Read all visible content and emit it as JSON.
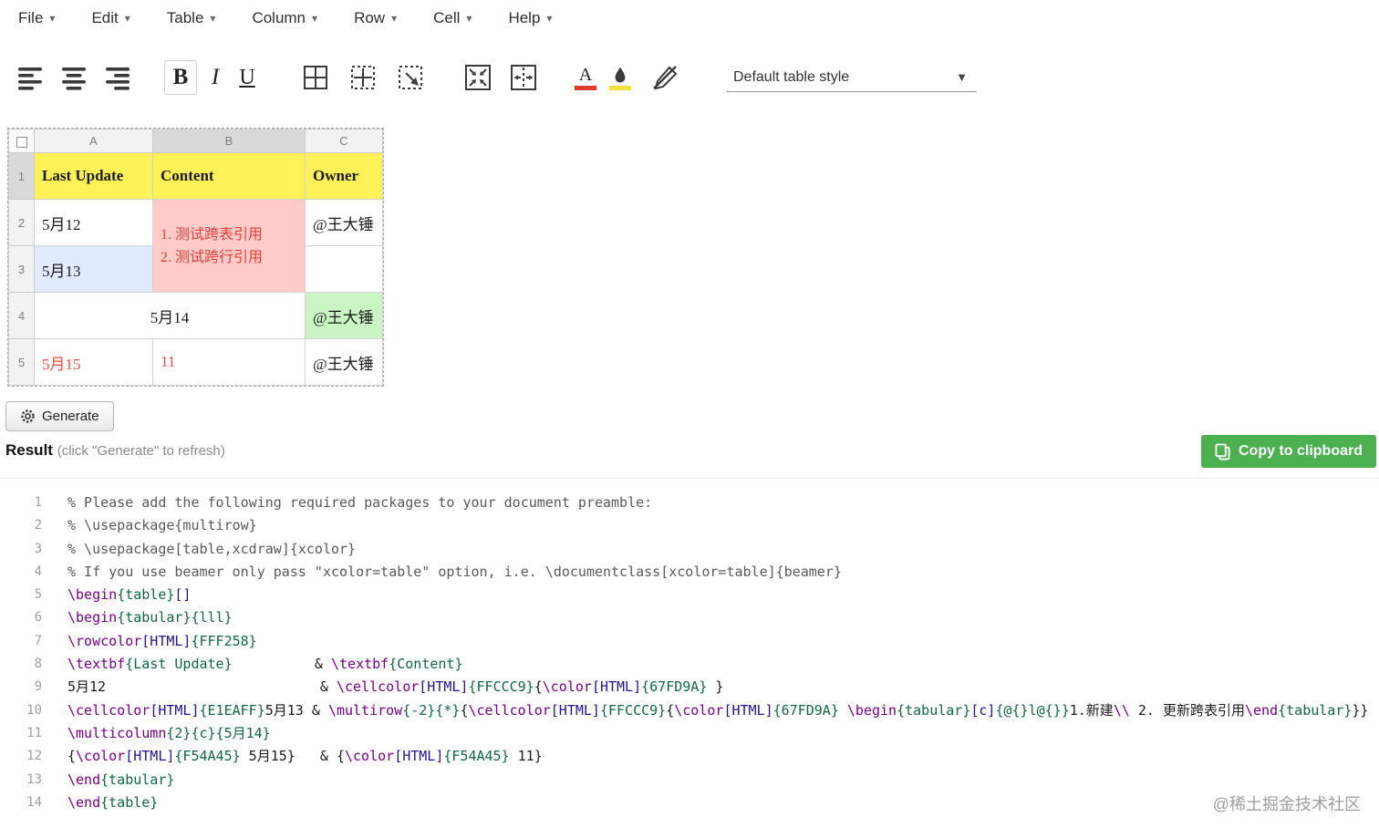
{
  "colors": {
    "copy_button": "#4caf50",
    "accent_red": "#e23b2e",
    "accent_yellow": "#f1e13d",
    "syntax": {
      "comment": "#595959",
      "command": "#770088",
      "brace_arg": "#116644",
      "bracket_arg": "#221199",
      "plain": "#1b1b1b"
    }
  },
  "icons": {
    "align-left-icon": "bars-left",
    "align-center-icon": "bars-center",
    "align-right-icon": "bars-right",
    "border-all-icon": "square-cross",
    "border-inner-icon": "dashed-square-cross",
    "border-custom-icon": "dashed-square-arrow",
    "merge-cells-icon": "box-arrows-inward",
    "split-cells-icon": "box-arrows-outward",
    "text-color-icon": "letter-A-red-bar",
    "fill-color-icon": "droplet-yellow-bar",
    "clear-formatting-icon": "pen-slash",
    "gear-icon": "cog",
    "clipboard-icon": "copy-sheets",
    "select-all-checkbox": "empty-square",
    "dropdown-caret-icon": "down-triangle"
  },
  "menu": {
    "items": [
      {
        "label": "File"
      },
      {
        "label": "Edit"
      },
      {
        "label": "Table"
      },
      {
        "label": "Column"
      },
      {
        "label": "Row"
      },
      {
        "label": "Cell"
      },
      {
        "label": "Help"
      }
    ]
  },
  "toolbar": {
    "bold_label": "B",
    "italic_label": "I",
    "underline_label": "U",
    "text_color_label": "A",
    "style_dropdown_value": "Default table style"
  },
  "grid": {
    "column_headers": [
      "A",
      "B",
      "C"
    ],
    "row_numbers": [
      "1",
      "2",
      "3",
      "4",
      "5"
    ],
    "cells": {
      "a1": {
        "text": "Last Update",
        "bg": "#FFF258"
      },
      "b1": {
        "text": "Content",
        "bg": "#FFF258"
      },
      "c1": {
        "text": "Owner",
        "bg": "#FFF258"
      },
      "a2": {
        "text": "5月12"
      },
      "b2": {
        "line1": "1.  测试跨表引用",
        "line2": "2.  测试跨行引用",
        "bg": "#FFCCC9",
        "color": "#E5403D"
      },
      "c2": {
        "text": "@王大锤"
      },
      "a3": {
        "text": "5月13",
        "bg": "#E1EAFF"
      },
      "c3": {
        "text": ""
      },
      "ab4": {
        "text": "5月14"
      },
      "c4": {
        "text": "@王大锤",
        "bg": "#CAF4C4"
      },
      "a5": {
        "text": "5月15",
        "color": "#F54A45"
      },
      "b5": {
        "text": "11",
        "color": "#F54A45"
      },
      "c5": {
        "text": "@王大锤"
      }
    }
  },
  "generate_button": {
    "label": "Generate"
  },
  "result": {
    "title": "Result",
    "hint": "(click \"Generate\" to refresh)",
    "copy_button": "Copy to clipboard"
  },
  "code": {
    "lines": [
      [
        [
          "c",
          "% Please add the following required packages to your document preamble:"
        ]
      ],
      [
        [
          "c",
          "% \\usepackage{multirow}"
        ]
      ],
      [
        [
          "c",
          "% \\usepackage[table,xcdraw]{xcolor}"
        ]
      ],
      [
        [
          "c",
          "% If you use beamer only pass \"xcolor=table\" option, i.e. \\documentclass[xcolor=table]{beamer}"
        ]
      ],
      [
        [
          "k",
          "\\begin"
        ],
        [
          "a",
          "{table}"
        ],
        [
          "b",
          "[]"
        ]
      ],
      [
        [
          "k",
          "\\begin"
        ],
        [
          "a",
          "{tabular}"
        ],
        [
          "a",
          "{lll}"
        ]
      ],
      [
        [
          "k",
          "\\rowcolor"
        ],
        [
          "b",
          "[HTML]"
        ],
        [
          "a",
          "{FFF258}"
        ],
        [
          "t",
          " "
        ]
      ],
      [
        [
          "k",
          "\\textbf"
        ],
        [
          "a",
          "{Last Update}"
        ],
        [
          "t",
          "          & "
        ],
        [
          "k",
          "\\textbf"
        ],
        [
          "a",
          "{Content}"
        ]
      ],
      [
        [
          "t",
          "5月12                          & "
        ],
        [
          "k",
          "\\cellcolor"
        ],
        [
          "b",
          "[HTML]"
        ],
        [
          "a",
          "{FFCCC9}"
        ],
        [
          "t",
          "{"
        ],
        [
          "k",
          "\\color"
        ],
        [
          "b",
          "[HTML]"
        ],
        [
          "a",
          "{67FD9A}"
        ],
        [
          "t",
          " }"
        ]
      ],
      [
        [
          "k",
          "\\cellcolor"
        ],
        [
          "b",
          "[HTML]"
        ],
        [
          "a",
          "{E1EAFF}"
        ],
        [
          "t",
          "5月13 & "
        ],
        [
          "k",
          "\\multirow"
        ],
        [
          "a",
          "{-2}"
        ],
        [
          "a",
          "{*}"
        ],
        [
          "t",
          "{"
        ],
        [
          "k",
          "\\cellcolor"
        ],
        [
          "b",
          "[HTML]"
        ],
        [
          "a",
          "{FFCCC9}"
        ],
        [
          "t",
          "{"
        ],
        [
          "k",
          "\\color"
        ],
        [
          "b",
          "[HTML]"
        ],
        [
          "a",
          "{67FD9A}"
        ],
        [
          "t",
          " "
        ],
        [
          "k",
          "\\begin"
        ],
        [
          "a",
          "{tabular}"
        ],
        [
          "b",
          "[c]"
        ],
        [
          "a",
          "{@{}l@{}}"
        ],
        [
          "t",
          "1.新建"
        ],
        [
          "k",
          "\\\\"
        ],
        [
          "t",
          " 2. 更新跨表引用"
        ],
        [
          "k",
          "\\end"
        ],
        [
          "a",
          "{tabular}"
        ],
        [
          "t",
          "}}"
        ]
      ],
      [
        [
          "k",
          "\\multicolumn"
        ],
        [
          "a",
          "{2}"
        ],
        [
          "a",
          "{c}"
        ],
        [
          "a",
          "{5月14}"
        ]
      ],
      [
        [
          "t",
          "{"
        ],
        [
          "k",
          "\\color"
        ],
        [
          "b",
          "[HTML]"
        ],
        [
          "a",
          "{F54A45}"
        ],
        [
          "t",
          " 5月15}   & {"
        ],
        [
          "k",
          "\\color"
        ],
        [
          "b",
          "[HTML]"
        ],
        [
          "a",
          "{F54A45}"
        ],
        [
          "t",
          " 11}"
        ]
      ],
      [
        [
          "k",
          "\\end"
        ],
        [
          "a",
          "{tabular}"
        ]
      ],
      [
        [
          "k",
          "\\end"
        ],
        [
          "a",
          "{table}"
        ]
      ]
    ]
  },
  "watermark": "@稀土掘金技术社区"
}
